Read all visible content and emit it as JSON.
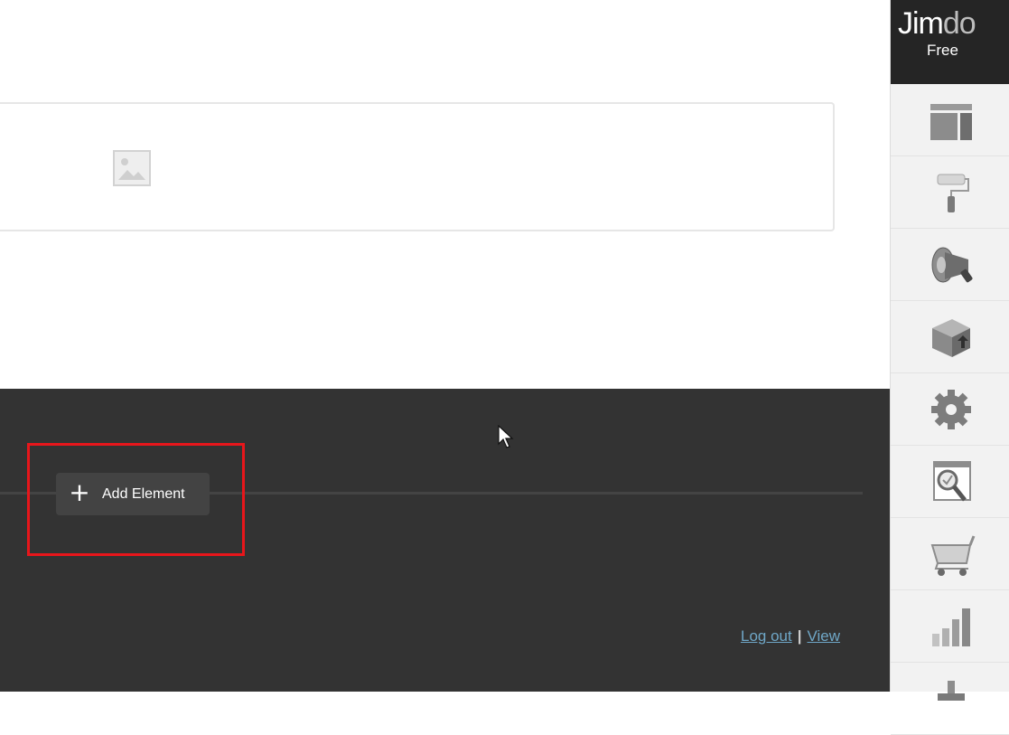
{
  "app": {
    "brand_prefix": "Jim",
    "brand_suffix": "do",
    "plan": "Free"
  },
  "editor": {
    "add_element_label": "Add Element",
    "add_element_icon": "plus-icon",
    "image_placeholder_icon": "image-icon"
  },
  "footer": {
    "logout_label": "Log out",
    "separator": "|",
    "view_label": "View"
  },
  "sidebar": {
    "items": [
      {
        "name": "layout",
        "icon": "layout-icon"
      },
      {
        "name": "design",
        "icon": "paint-roller-icon"
      },
      {
        "name": "marketing",
        "icon": "megaphone-icon"
      },
      {
        "name": "upgrade",
        "icon": "box-icon"
      },
      {
        "name": "settings",
        "icon": "gear-icon"
      },
      {
        "name": "seo",
        "icon": "magnifier-icon"
      },
      {
        "name": "store",
        "icon": "cart-icon"
      },
      {
        "name": "statistics",
        "icon": "bar-chart-icon"
      },
      {
        "name": "more",
        "icon": "stamp-icon"
      }
    ]
  },
  "colors": {
    "footer_bg": "#333333",
    "highlight": "#e8161b",
    "link": "#6fa7c7",
    "sidebar_bg": "#f2f2f2",
    "brand_bg": "#252525"
  }
}
